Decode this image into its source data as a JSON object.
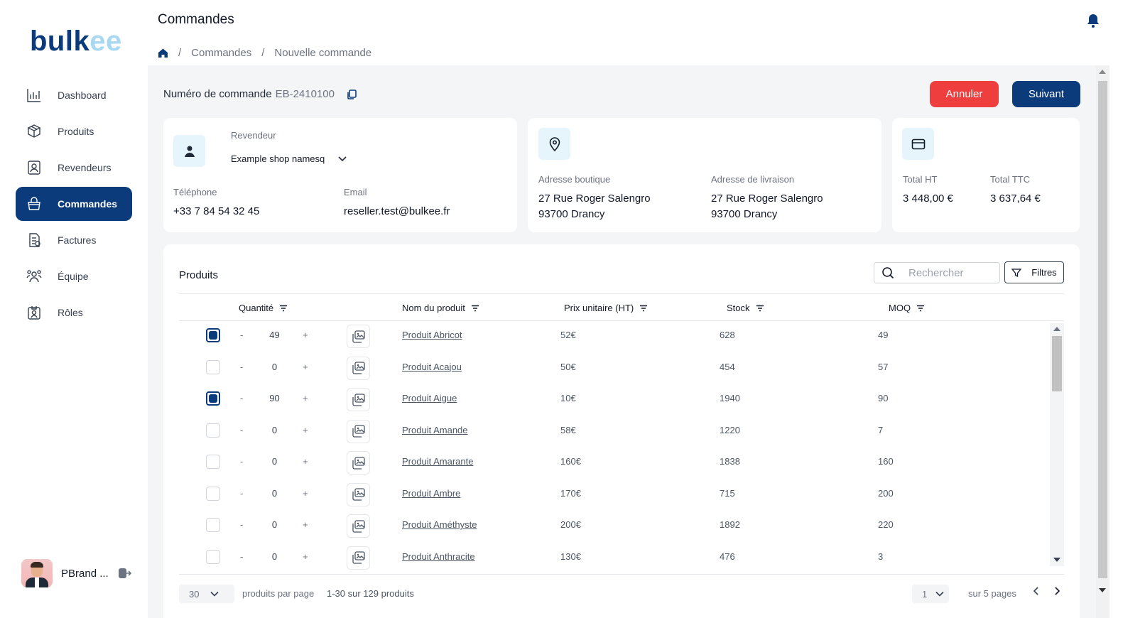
{
  "logo": {
    "part1": "bulk",
    "part2": "ee"
  },
  "sidebar": {
    "items": [
      {
        "label": "Dashboard",
        "icon": "chart-bar-icon"
      },
      {
        "label": "Produits",
        "icon": "box-icon"
      },
      {
        "label": "Revendeurs",
        "icon": "contact-card-icon"
      },
      {
        "label": "Commandes",
        "icon": "shopping-bag-icon",
        "active": true
      },
      {
        "label": "Factures",
        "icon": "invoice-icon"
      },
      {
        "label": "Équipe",
        "icon": "team-icon"
      },
      {
        "label": "Rôles",
        "icon": "role-badge-icon"
      }
    ],
    "user": {
      "name": "PBrand ..."
    }
  },
  "header": {
    "title": "Commandes",
    "breadcrumb": [
      "Commandes",
      "Nouvelle commande"
    ]
  },
  "order": {
    "number_label": "Numéro de commande",
    "number_value": "EB-2410100",
    "cancel_label": "Annuler",
    "next_label": "Suivant"
  },
  "reseller": {
    "label": "Revendeur",
    "selected": "Example shop namesq",
    "phone_label": "Téléphone",
    "phone": "+33 7 84 54 32 45",
    "email_label": "Email",
    "email": "reseller.test@bulkee.fr"
  },
  "address": {
    "shop_label": "Adresse boutique",
    "shop_line1": "27 Rue Roger Salengro",
    "shop_line2": "93700 Drancy",
    "delivery_label": "Adresse de livraison",
    "delivery_line1": "27 Rue Roger Salengro",
    "delivery_line2": "93700 Drancy"
  },
  "totals": {
    "ht_label": "Total HT",
    "ht": "3 448,00 €",
    "ttc_label": "Total TTC",
    "ttc": "3 637,64 €"
  },
  "products": {
    "title": "Produits",
    "search_placeholder": "Rechercher",
    "filters_label": "Filtres",
    "columns": {
      "quantity": "Quantité",
      "name": "Nom du produit",
      "price": "Prix unitaire (HT)",
      "stock": "Stock",
      "moq": "MOQ"
    },
    "minus": "-",
    "plus": "+",
    "rows": [
      {
        "checked": true,
        "qty": "49",
        "name": "Produit Abricot",
        "price": "52€",
        "stock": "628",
        "moq": "49"
      },
      {
        "checked": false,
        "qty": "0",
        "name": "Produit Acajou",
        "price": "50€",
        "stock": "454",
        "moq": "57"
      },
      {
        "checked": true,
        "qty": "90",
        "name": "Produit Aigue",
        "price": "10€",
        "stock": "1940",
        "moq": "90"
      },
      {
        "checked": false,
        "qty": "0",
        "name": "Produit Amande",
        "price": "58€",
        "stock": "1220",
        "moq": "7"
      },
      {
        "checked": false,
        "qty": "0",
        "name": "Produit Amarante",
        "price": "160€",
        "stock": "1838",
        "moq": "160"
      },
      {
        "checked": false,
        "qty": "0",
        "name": "Produit Ambre",
        "price": "170€",
        "stock": "715",
        "moq": "200"
      },
      {
        "checked": false,
        "qty": "0",
        "name": "Produit Améthyste",
        "price": "200€",
        "stock": "1892",
        "moq": "220"
      },
      {
        "checked": false,
        "qty": "0",
        "name": "Produit Anthracite",
        "price": "130€",
        "stock": "476",
        "moq": "3"
      }
    ],
    "footer": {
      "per_page": "30",
      "per_page_label": "produits par page",
      "range": "1-30 sur 129 produits",
      "page": "1",
      "page_total": "sur 5 pages"
    }
  },
  "colors": {
    "primary": "#0b3b7a",
    "danger": "#ef3e3e",
    "accent_light": "#a9d8f2",
    "icon_bg": "#e6f4fb"
  }
}
